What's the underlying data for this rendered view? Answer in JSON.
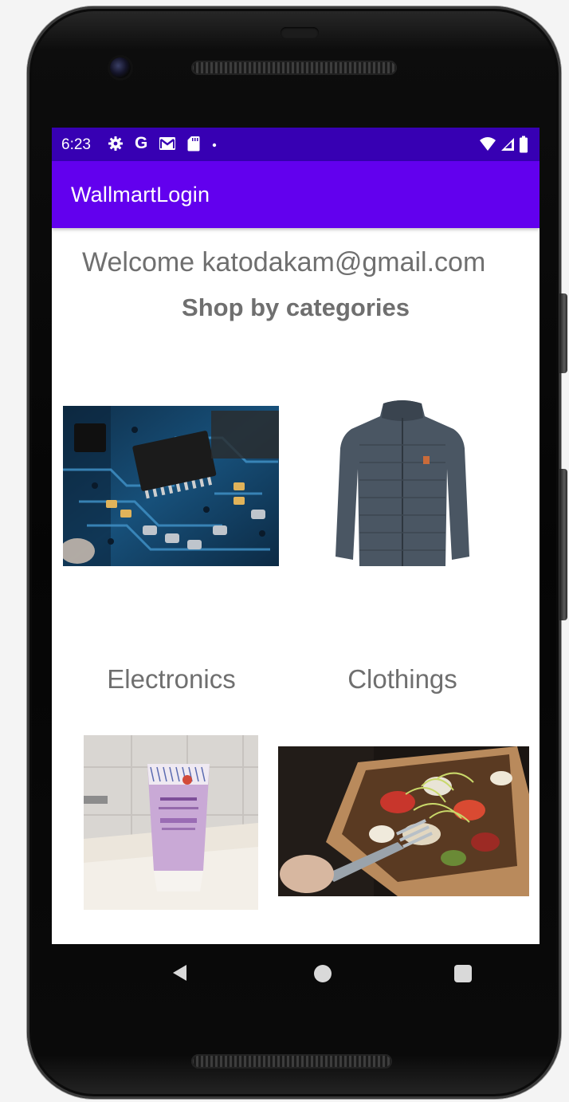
{
  "status_bar": {
    "time": "6:23",
    "left_icons": [
      "gear-icon",
      "google-icon",
      "gmail-icon",
      "sd-card-icon",
      "dot-icon"
    ],
    "google_letter": "G",
    "right_icons": [
      "wifi-icon",
      "signal-icon",
      "battery-icon"
    ]
  },
  "app_bar": {
    "title": "WallmartLogin"
  },
  "main": {
    "welcome_text": "Welcome katodakam@gmail.com",
    "section_title": "Shop by categories",
    "categories": [
      {
        "label": "Electronics",
        "image": "circuit-board-image"
      },
      {
        "label": "Clothings",
        "image": "jacket-image"
      },
      {
        "label": "",
        "image": "lotion-tube-image"
      },
      {
        "label": "",
        "image": "salad-box-image"
      }
    ]
  },
  "nav_bar": {
    "icons": [
      "back-icon",
      "home-icon",
      "recents-icon"
    ]
  },
  "colors": {
    "status_bar": "#3700b3",
    "app_bar": "#6200ee",
    "text_gray": "#6f6f6f",
    "screen_bg": "#ffffff"
  }
}
